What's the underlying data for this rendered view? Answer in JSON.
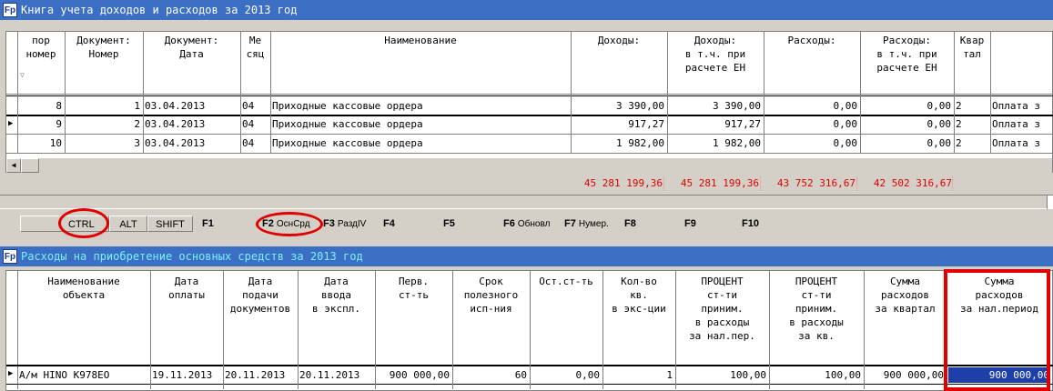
{
  "window1": {
    "icon": "Fp",
    "title": "Книга учета доходов и расходов за 2013 год",
    "headers": [
      "пор\nномер",
      "Документ:\nНомер",
      "Документ:\nДата",
      "Ме\nсяц",
      "Наименование",
      "Доходы:",
      "Доходы:\nв т.ч. при\nрасчете ЕН",
      "Расходы:",
      "Расходы:\nв т.ч. при\nрасчете ЕН",
      "Квар\nтал",
      ""
    ],
    "rows": [
      [
        "8",
        "1",
        "03.04.2013",
        "04",
        "Приходные кассовые ордера",
        "3 390,00",
        "3 390,00",
        "0,00",
        "0,00",
        "2",
        "Оплата з"
      ],
      [
        "9",
        "2",
        "03.04.2013",
        "04",
        "Приходные кассовые ордера",
        "917,27",
        "917,27",
        "0,00",
        "0,00",
        "2",
        "Оплата з"
      ],
      [
        "10",
        "3",
        "03.04.2013",
        "04",
        "Приходные кассовые ордера",
        "1 982,00",
        "1 982,00",
        "0,00",
        "0,00",
        "2",
        "Оплата з"
      ]
    ],
    "totals": [
      "45 281 199,36",
      "45 281 199,36",
      "43 752 316,67",
      "42 502 316,67"
    ]
  },
  "fkeys": {
    "ctrl": "CTRL",
    "alt": "ALT",
    "shift": "SHIFT",
    "f1": "F1",
    "f2": "F2",
    "f2_label": "ОснСрд",
    "f3": "F3",
    "f3_label": "РаздIV",
    "f4": "F4",
    "f5": "F5",
    "f6": "F6",
    "f6_label": "Обновл",
    "f7": "F7",
    "f7_label": "Нумер.",
    "f8": "F8",
    "f9": "F9",
    "f10": "F10"
  },
  "window2": {
    "icon": "Fp",
    "title": "Расходы на приобретение основных средств за 2013 год",
    "headers": [
      "Наименование\nобъекта",
      "Дата\nоплаты",
      "Дата\nподачи\nдокументов",
      "Дата\nввода\nв экспл.",
      "Перв.\nст-ть",
      "Срок\nполезного\nисп-ния",
      "Ост.ст-ть",
      "Кол-во\nкв.\nв экс-ции",
      "ПРОЦЕНТ\nст-ти\nприним.\nв расходы\nза нал.пер.",
      "ПРОЦЕНТ\nст-ти\nприним.\nв расходы\nза кв.",
      "Сумма\nрасходов\nза квартал",
      "Сумма\nрасходов\nза нал.период"
    ],
    "row": [
      "А/м HINO K978EO",
      "19.11.2013",
      "20.11.2013",
      "20.11.2013",
      "900 000,00",
      "60",
      "0,00",
      "1",
      "100,00",
      "100,00",
      "900 000,00",
      "900 000,00"
    ]
  },
  "colors": {
    "title_bg": "#3a6fc4",
    "highlight": "#e00000",
    "selected_cell": "#1e3fa8"
  }
}
